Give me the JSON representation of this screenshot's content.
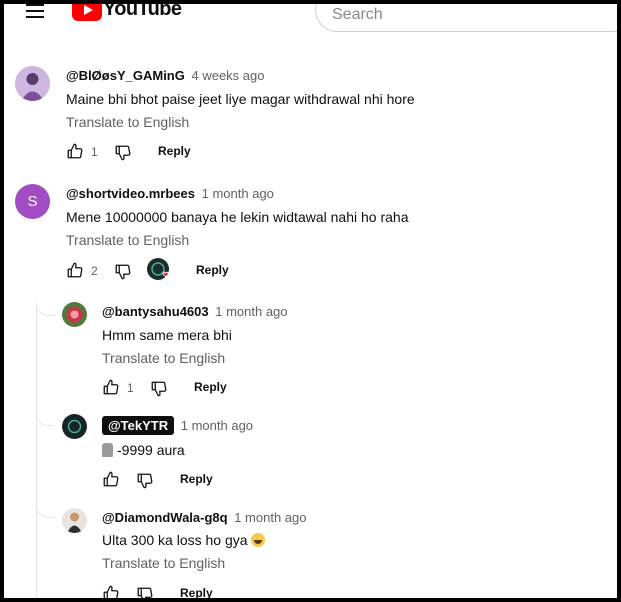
{
  "header": {
    "logo_text": "YouTube",
    "search_placeholder": "Search"
  },
  "comments": [
    {
      "author": "@BlØøsY_GAMinG",
      "time": "4 weeks ago",
      "text": "Maine bhi bhot paise jeet liye magar withdrawal nhi hore",
      "translate": "Translate to English",
      "likes": "1",
      "reply": "Reply"
    },
    {
      "author": "@shortvideo.mrbees",
      "avatar_letter": "S",
      "time": "1 month ago",
      "text": "Mene 10000000 banaya he lekin widtawal nahi ho raha",
      "translate": "Translate to English",
      "likes": "2",
      "reply": "Reply"
    }
  ],
  "replies": [
    {
      "author": "@bantysahu4603",
      "time": "1 month ago",
      "text": "Hmm same mera bhi",
      "translate": "Translate to English",
      "likes": "1",
      "reply": "Reply"
    },
    {
      "author": "@TekYTR",
      "time": "1 month ago",
      "text": "-9999 aura",
      "reply": "Reply"
    },
    {
      "author": "@DiamondWala-g8q",
      "time": "1 month ago",
      "text": "Ulta 300 ka loss ho gya",
      "translate": "Translate to English",
      "reply": "Reply"
    }
  ],
  "colors": {
    "brand": "#ff0000",
    "avatar_s": "#a24cc4",
    "heart": "#e8203a"
  }
}
